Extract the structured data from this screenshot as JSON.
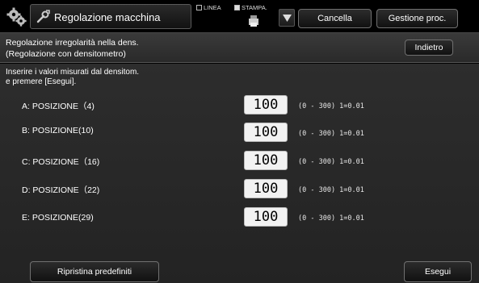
{
  "topbar": {
    "title": "Regolazione macchina",
    "mode_linea": "LINEA",
    "mode_stampa": "STAMPA.",
    "cancel_label": "Cancella",
    "job_label": "Gestione proc."
  },
  "header": {
    "line1": "Regolazione irregolarità nella dens.",
    "line2": "(Regolazione con densitometro)",
    "back_label": "Indietro"
  },
  "main": {
    "instruction_line1": "Inserire i valori misurati dal densitom.",
    "instruction_line2": "e premere [Esegui].",
    "rows": [
      {
        "label": "A: POSIZIONE（4)",
        "value": "100",
        "range": "(0 - 300) 1=0.01"
      },
      {
        "label": "B: POSIZIONE(10)",
        "value": "100",
        "range": "(0 - 300) 1=0.01"
      },
      {
        "label": "C: POSIZIONE（16)",
        "value": "100",
        "range": "(0 - 300) 1=0.01"
      },
      {
        "label": "D: POSIZIONE（22)",
        "value": "100",
        "range": "(0 - 300) 1=0.01"
      },
      {
        "label": "E: POSIZIONE(29)",
        "value": "100",
        "range": "(0 - 300) 1=0.01"
      }
    ],
    "reset_label": "Ripristina predefiniti",
    "execute_label": "Esegui"
  },
  "icons": {
    "settings": "gear-icon",
    "tool": "wrench-icon",
    "printer": "printer-icon",
    "dropdown": "triangle-down-icon"
  }
}
